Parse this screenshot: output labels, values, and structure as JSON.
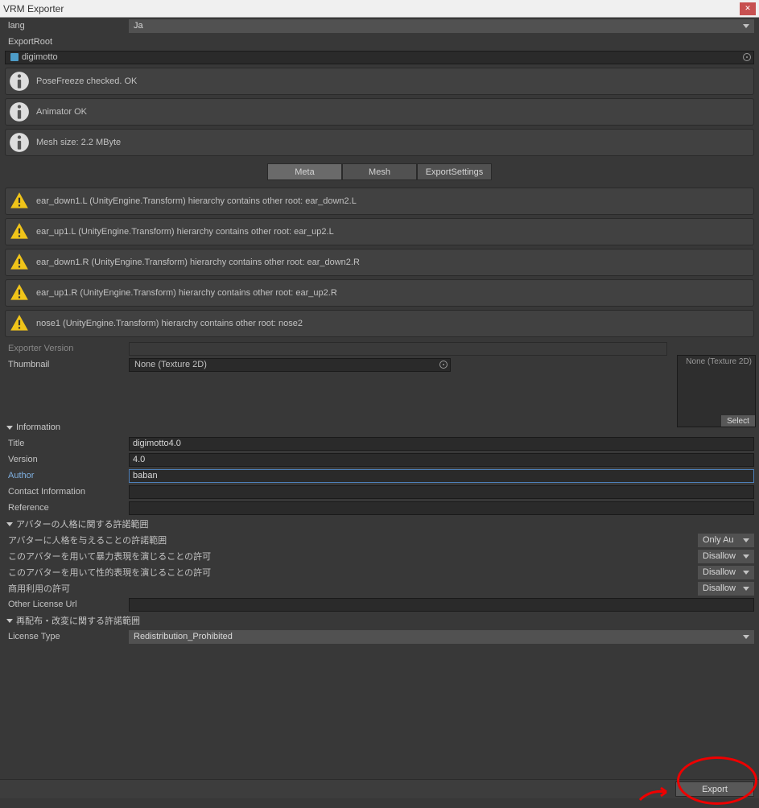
{
  "window": {
    "title": "VRM Exporter"
  },
  "lang": {
    "label": "lang",
    "value": "Ja"
  },
  "exportRoot": {
    "label": "ExportRoot",
    "value": "digimotto"
  },
  "infoMessages": [
    "PoseFreeze checked. OK",
    "Animator OK",
    "Mesh size: 2.2 MByte"
  ],
  "tabs": {
    "meta": "Meta",
    "mesh": "Mesh",
    "exportSettings": "ExportSettings"
  },
  "warnings": [
    "ear_down1.L (UnityEngine.Transform) hierarchy contains other root: ear_down2.L",
    "ear_up1.L (UnityEngine.Transform) hierarchy contains other root: ear_up2.L",
    "ear_down1.R (UnityEngine.Transform) hierarchy contains other root: ear_down2.R",
    "ear_up1.R (UnityEngine.Transform) hierarchy contains other root: ear_up2.R",
    "nose1 (UnityEngine.Transform) hierarchy contains other root: nose2"
  ],
  "exporterVersion": {
    "label": "Exporter Version"
  },
  "thumbnail": {
    "label": "Thumbnail",
    "value": "None (Texture 2D)",
    "box_text": "None (Texture 2D)",
    "select": "Select"
  },
  "information": {
    "header": "Information",
    "title": {
      "label": "Title",
      "value": "digimotto4.0"
    },
    "version": {
      "label": "Version",
      "value": "4.0"
    },
    "author": {
      "label": "Author",
      "value": "baban"
    },
    "contact": {
      "label": "Contact Information",
      "value": ""
    },
    "reference": {
      "label": "Reference",
      "value": ""
    }
  },
  "avatarPerm": {
    "header": "アバターの人格に関する許諾範囲",
    "allowed": {
      "label": "アバターに人格を与えることの許諾範囲",
      "value": "Only Au"
    },
    "violent": {
      "label": "このアバターを用いて暴力表現を演じることの許可",
      "value": "Disallow"
    },
    "sexual": {
      "label": "このアバターを用いて性的表現を演じることの許可",
      "value": "Disallow"
    },
    "commercial": {
      "label": "商用利用の許可",
      "value": "Disallow"
    },
    "otherUrl": {
      "label": "Other License Url",
      "value": ""
    }
  },
  "redistribution": {
    "header": "再配布・改変に関する許諾範囲",
    "licenseType": {
      "label": "License Type",
      "value": "Redistribution_Prohibited"
    }
  },
  "export": {
    "label": "Export"
  }
}
